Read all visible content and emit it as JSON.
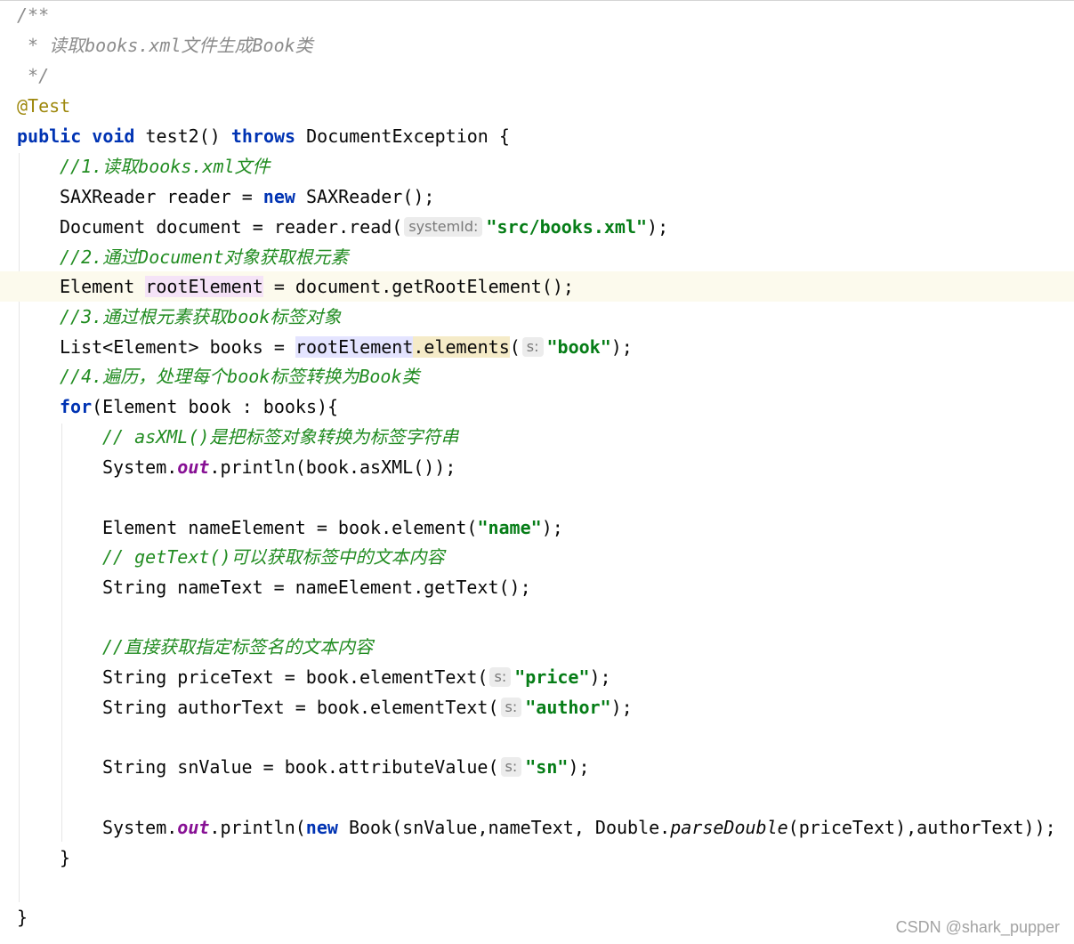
{
  "lines": {
    "l1": "/**",
    "l2": " * 读取books.xml文件生成Book类",
    "l3": " */",
    "l4": "@Test",
    "l5": {
      "kw1": "public",
      "kw2": "void",
      "name": " test2() ",
      "kw3": "throws",
      "tail": " DocumentException {"
    },
    "l6": "//1.读取books.xml文件",
    "l7": {
      "a": "SAXReader reader = ",
      "kw": "new",
      "b": " SAXReader();"
    },
    "l8": {
      "a": "Document document = reader.read(",
      "hint": "systemId:",
      "str": "\"src/books.xml\"",
      "b": ");"
    },
    "l9": "//2.通过Document对象获取根元素",
    "l10": {
      "a": "Element ",
      "var": "rootElement",
      "b": " = document.getRootElement();"
    },
    "l11": "//3.通过根元素获取book标签对象",
    "l12": {
      "a": "List<Element> books = ",
      "var": "rootElement",
      "call": ".elements",
      "b": "(",
      "hint": "s:",
      "str": "\"book\"",
      "c": ");"
    },
    "l13": "//4.遍历，处理每个book标签转换为Book类",
    "l14": {
      "kw": "for",
      "b": "(Element book : books){"
    },
    "l15": "// asXML()是把标签对象转换为标签字符串",
    "l16": {
      "a": "System.",
      "fld": "out",
      "b": ".println(book.asXML());"
    },
    "l18": {
      "a": "Element nameElement = book.element(",
      "str": "\"name\"",
      "b": ");"
    },
    "l19": "// getText()可以获取标签中的文本内容",
    "l20": "String nameText = nameElement.getText();",
    "l22": "//直接获取指定标签名的文本内容",
    "l23": {
      "a": "String priceText = book.elementText(",
      "hint": "s:",
      "str": "\"price\"",
      "b": ");"
    },
    "l24": {
      "a": "String authorText = book.elementText(",
      "hint": "s:",
      "str": "\"author\"",
      "b": ");"
    },
    "l26": {
      "a": "String snValue = book.attributeValue(",
      "hint": "s:",
      "str": "\"sn\"",
      "b": ");"
    },
    "l28": {
      "a": "System.",
      "fld": "out",
      "b": ".println(",
      "kw": "new",
      "c": " Book(snValue,nameText, Double.",
      "stat": "parseDouble",
      "d": "(priceText),authorText));"
    },
    "l29": "}",
    "l31": "}"
  },
  "watermark": "CSDN @shark_pupper"
}
